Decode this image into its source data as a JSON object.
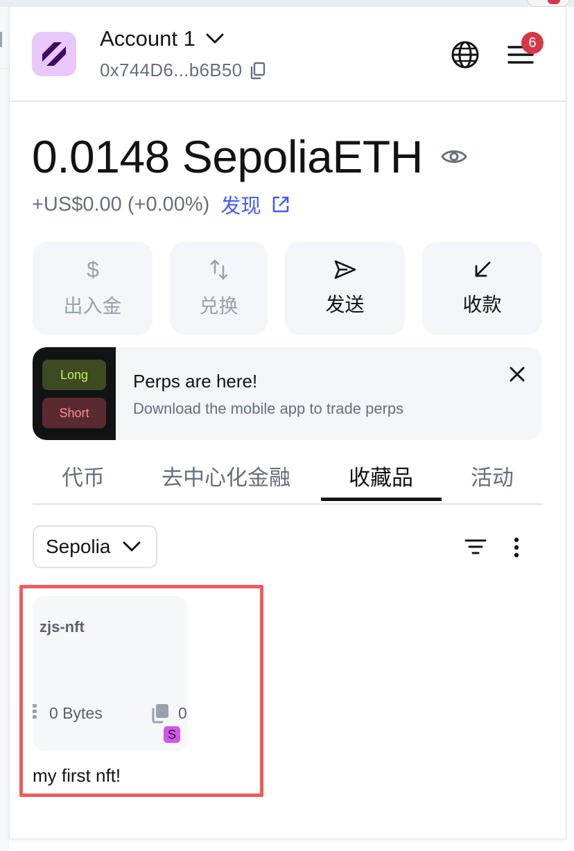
{
  "header": {
    "account_name": "Account 1",
    "address": "0x744D6...b6B50",
    "notification_count": "6"
  },
  "balance": {
    "amount": "0.0148 SepoliaETH",
    "change": "+US$0.00 (+0.00%)",
    "discover_label": "发现"
  },
  "actions": [
    {
      "label": "出入金",
      "icon": "dollar-icon",
      "enabled": false
    },
    {
      "label": "兑换",
      "icon": "swap-icon",
      "enabled": false
    },
    {
      "label": "发送",
      "icon": "send-icon",
      "enabled": true
    },
    {
      "label": "收款",
      "icon": "receive-icon",
      "enabled": true
    }
  ],
  "banner": {
    "long_label": "Long",
    "short_label": "Short",
    "title": "Perps are here!",
    "subtitle": "Download the mobile app to trade perps"
  },
  "tabs": [
    {
      "label": "代币",
      "active": false
    },
    {
      "label": "去中心化金融",
      "active": false
    },
    {
      "label": "收藏品",
      "active": true
    },
    {
      "label": "活动",
      "active": false
    }
  ],
  "filters": {
    "network": "Sepolia"
  },
  "nft": {
    "collection": "zjs-nft",
    "size": "0 Bytes",
    "copies": "0",
    "network_badge": "S",
    "title": "my first nft!"
  },
  "colors": {
    "accent_link": "#4459ff",
    "badge": "#d73847",
    "highlight_box": "#f25a5c",
    "avatar_bg": "#e8c7fb"
  }
}
